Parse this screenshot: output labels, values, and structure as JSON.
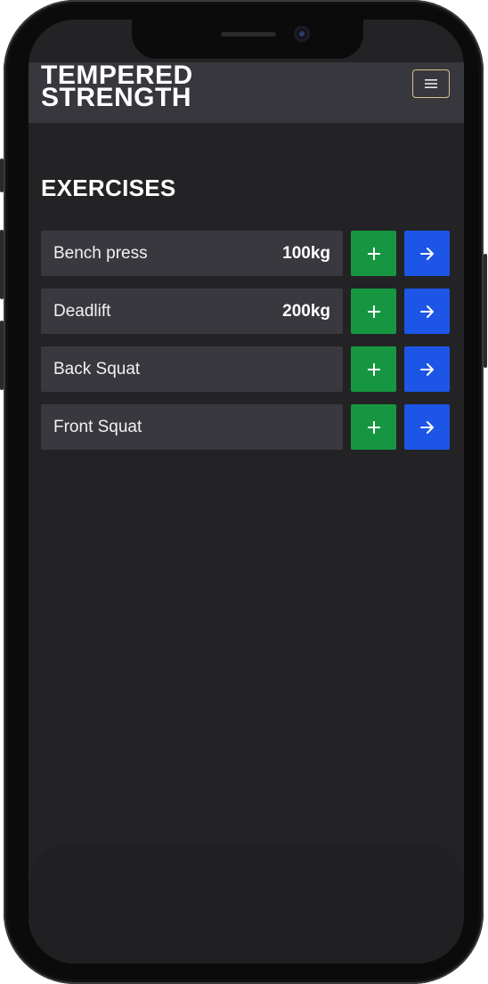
{
  "app": {
    "brand_line1": "TEMPERED",
    "brand_line2": "STRENGTH",
    "menu_icon": "hamburger-icon"
  },
  "page": {
    "title": "EXERCISES"
  },
  "exercises": [
    {
      "name": "Bench press",
      "weight": "100kg"
    },
    {
      "name": "Deadlift",
      "weight": "200kg"
    },
    {
      "name": "Back Squat",
      "weight": ""
    },
    {
      "name": "Front Squat",
      "weight": ""
    }
  ],
  "icons": {
    "add": "plus-icon",
    "open": "arrow-right-icon"
  },
  "colors": {
    "background": "#232325",
    "header": "#38373d",
    "row": "#39383e",
    "add_button": "#169641",
    "open_button": "#1d55e6",
    "menu_border": "#d8c38a"
  }
}
